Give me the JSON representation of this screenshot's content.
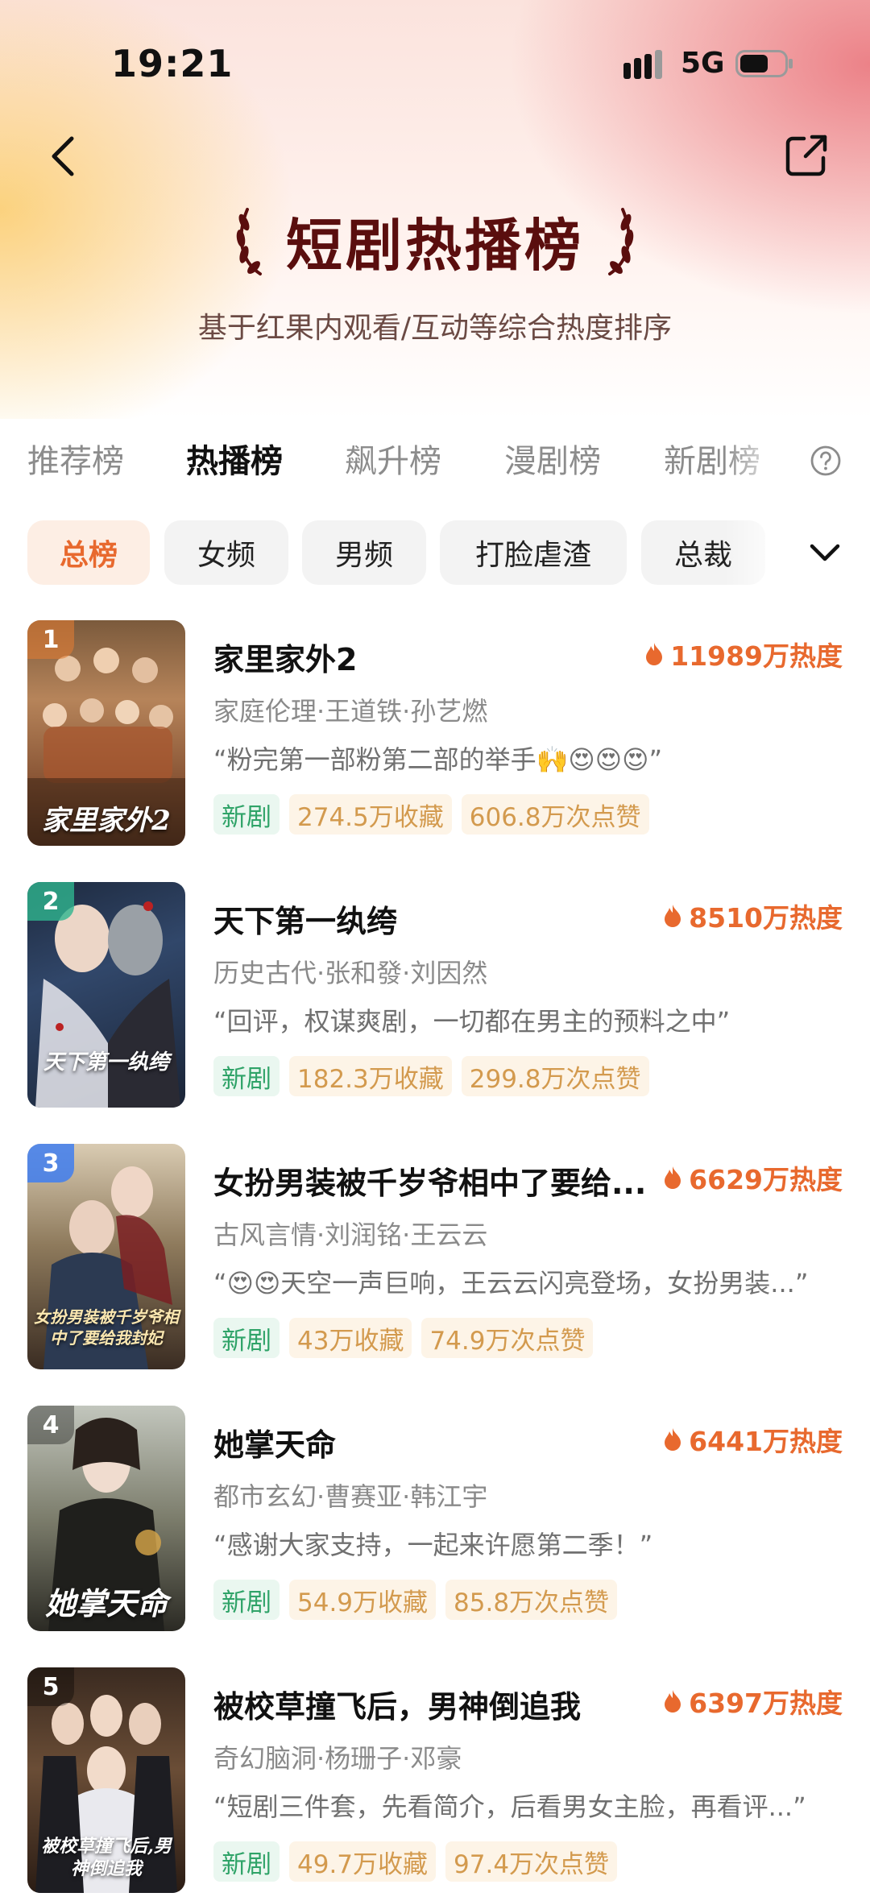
{
  "status_bar": {
    "time": "19:21",
    "network": "5G"
  },
  "header": {
    "title": "短剧热播榜",
    "subtitle": "基于红果内观看/互动等综合热度排序"
  },
  "tabs": [
    {
      "label": "推荐榜",
      "active": false
    },
    {
      "label": "热播榜",
      "active": true
    },
    {
      "label": "飙升榜",
      "active": false
    },
    {
      "label": "漫剧榜",
      "active": false
    },
    {
      "label": "新剧榜",
      "active": false
    }
  ],
  "chips": [
    {
      "label": "总榜",
      "active": true
    },
    {
      "label": "女频",
      "active": false
    },
    {
      "label": "男频",
      "active": false
    },
    {
      "label": "打脸虐渣",
      "active": false
    },
    {
      "label": "总裁",
      "active": false
    }
  ],
  "colors": {
    "accent": "#e8692e",
    "title": "#5a0e0e",
    "rank_1": "#e07b33",
    "rank_2": "#2fb58f",
    "rank_3": "#3f7ef0",
    "rank_other": "rgba(0,0,0,0.35)"
  },
  "items": [
    {
      "rank": "1",
      "title": "家里家外2",
      "cover_text": "家里家外2",
      "heat": "11989万热度",
      "meta": "家庭伦理·王道铁·孙艺燃",
      "review": "“粉完第一部粉第二部的举手🙌😍😍😍”",
      "tag_new": "新剧",
      "favorites": "274.5万收藏",
      "likes": "606.8万次点赞"
    },
    {
      "rank": "2",
      "title": "天下第一纨绔",
      "cover_text": "天下第一纨绔",
      "heat": "8510万热度",
      "meta": "历史古代·张和發·刘因然",
      "review": "“回评，权谋爽剧，一切都在男主的预料之中”",
      "tag_new": "新剧",
      "favorites": "182.3万收藏",
      "likes": "299.8万次点赞"
    },
    {
      "rank": "3",
      "title": "女扮男装被千岁爷相中了要给...",
      "cover_text": "女扮男装被千岁爷相中了要给我封妃",
      "heat": "6629万热度",
      "meta": "古风言情·刘润铭·王云云",
      "review": "“😍😍天空一声巨响，王云云闪亮登场，女扮男装...”",
      "tag_new": "新剧",
      "favorites": "43万收藏",
      "likes": "74.9万次点赞"
    },
    {
      "rank": "4",
      "title": "她掌天命",
      "cover_text": "她掌天命",
      "heat": "6441万热度",
      "meta": "都市玄幻·曹赛亚·韩江宇",
      "review": "“感谢大家支持，一起来许愿第二季！”",
      "tag_new": "新剧",
      "favorites": "54.9万收藏",
      "likes": "85.8万次点赞"
    },
    {
      "rank": "5",
      "title": "被校草撞飞后，男神倒追我",
      "cover_text": "被校草撞飞后,男神倒追我",
      "heat": "6397万热度",
      "meta": "奇幻脑洞·杨珊子·邓豪",
      "review": "“短剧三件套，先看简介，后看男女主脸，再看评...”",
      "tag_new": "新剧",
      "favorites": "49.7万收藏",
      "likes": "97.4万次点赞"
    }
  ]
}
